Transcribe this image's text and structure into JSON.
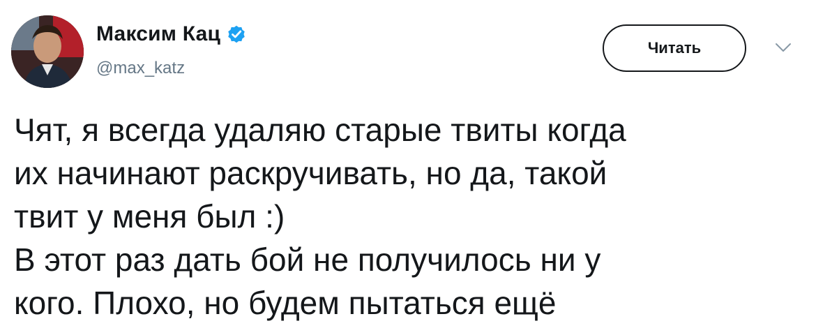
{
  "author": {
    "display_name": "Максим Кац",
    "handle": "@max_katz",
    "verified_icon": "verified-badge-icon",
    "avatar_icon": "avatar-photo"
  },
  "actions": {
    "follow_label": "Читать",
    "menu_icon": "chevron-down-icon"
  },
  "tweet": {
    "text": "Чят, я всегда удаляю старые твиты когда\nих начинают раскручивать, но да, такой\nтвит у меня был :)\nВ этот раз дать бой не получилось ни у\nкого. Плохо, но будем пытаться ещё"
  },
  "colors": {
    "verified": "#1da1f2",
    "text": "#14171a",
    "secondary": "#657786"
  }
}
